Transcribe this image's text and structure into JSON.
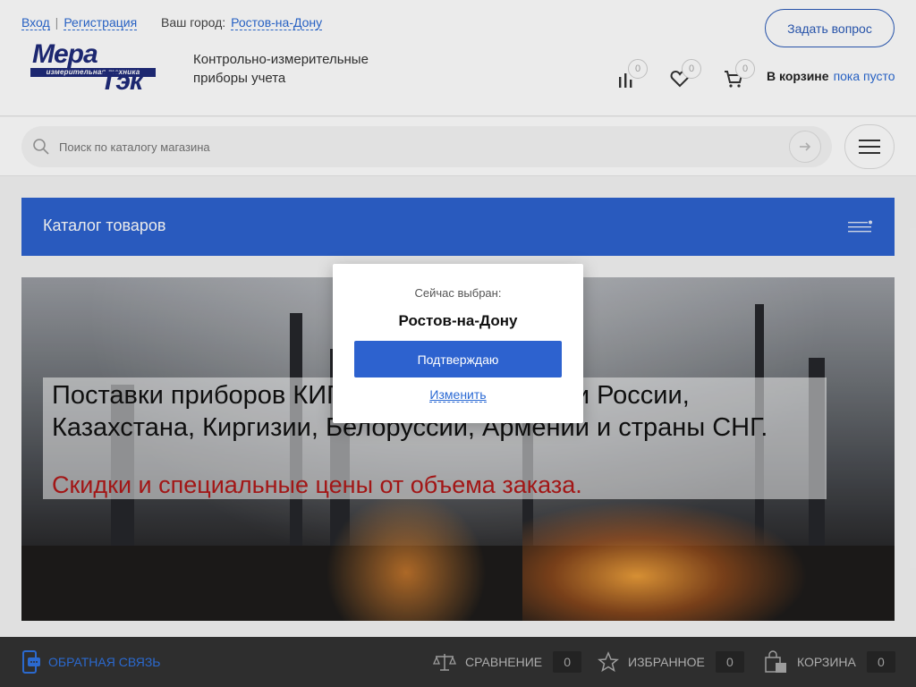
{
  "header": {
    "login": "Вход",
    "register": "Регистрация",
    "city_label": "Ваш город:",
    "city": "Ростов-на-Дону",
    "ask_button": "Задать вопрос",
    "logo": {
      "word1": "Мера",
      "band": "измерительная техника",
      "word2": "Тэк"
    },
    "tagline": "Контрольно-измерительные приборы учета",
    "counters": {
      "compare": "0",
      "favorites": "0",
      "cart": "0"
    },
    "cart_label": "В корзине",
    "cart_status": "пока пусто"
  },
  "search": {
    "placeholder": "Поиск по каталогу магазина"
  },
  "catalog": {
    "title": "Каталог товаров"
  },
  "banner": {
    "line1": "Поставки приборов КИП по всей территории России, Казахстана, Киргизии, Белоруссии, Армении и страны СНГ.",
    "line2": "Скидки и специальные цены от объема заказа."
  },
  "modal": {
    "now_selected": "Сейчас выбран:",
    "city": "Ростов-на-Дону",
    "confirm": "Подтверждаю",
    "change": "Изменить"
  },
  "bottom": {
    "feedback": "Обратная связь",
    "compare": "Сравнение",
    "compare_count": "0",
    "favorites": "Избранное",
    "favorites_count": "0",
    "cart": "Корзина",
    "cart_count": "0"
  },
  "colors": {
    "accent": "#2d62cf",
    "link": "#2b6ad4",
    "promo": "#b01818",
    "bottom_bar": "#323232"
  }
}
